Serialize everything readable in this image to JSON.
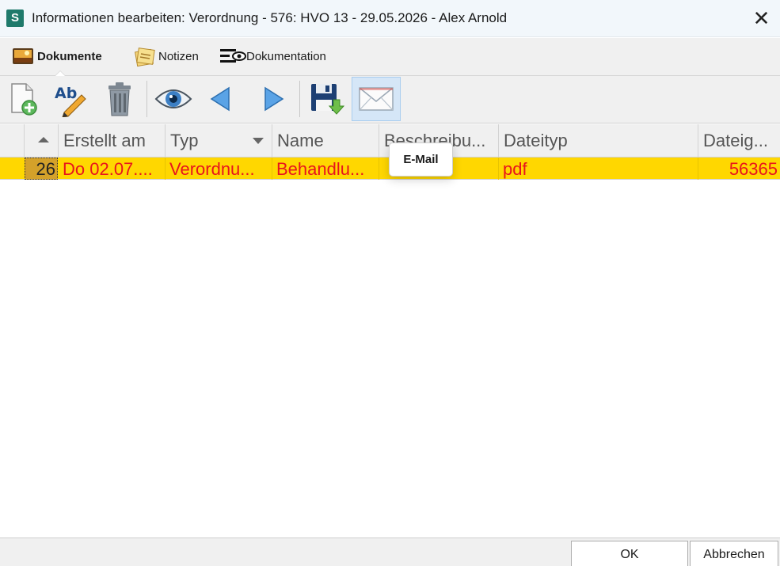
{
  "window": {
    "app_icon_letter": "S",
    "title": "Informationen bearbeiten: Verordnung - 576: HVO 13 - 29.05.2026 - Alex Arnold",
    "close_glyph": "✕"
  },
  "tabs": [
    {
      "label": "Dokumente",
      "icon": "picture-icon",
      "active": true
    },
    {
      "label": "Notizen",
      "icon": "notes-icon",
      "active": false
    },
    {
      "label": "Dokumentation",
      "icon": "documentation-eye-icon",
      "active": false
    }
  ],
  "toolbar": {
    "buttons": [
      {
        "name": "new-document",
        "icon": "new-document-icon"
      },
      {
        "name": "rename",
        "icon": "rename-pencil-icon"
      },
      {
        "name": "delete",
        "icon": "trash-icon"
      },
      {
        "name": "view",
        "icon": "eye-icon"
      },
      {
        "name": "previous",
        "icon": "arrow-left-icon"
      },
      {
        "name": "next",
        "icon": "arrow-right-icon"
      },
      {
        "name": "save",
        "icon": "save-download-icon"
      },
      {
        "name": "email",
        "icon": "envelope-icon",
        "hovered": true
      }
    ],
    "tooltip": "E-Mail"
  },
  "grid": {
    "columns": [
      "Erstellt am",
      "Typ",
      "Name",
      "Beschreibu...",
      "Dateityp",
      "Dateig..."
    ],
    "sort_indicator": "ascending",
    "rows": [
      {
        "id": "26",
        "cells": [
          "Do 02.07....",
          "Verordnu...",
          "Behandlu...",
          "",
          "pdf",
          "56365"
        ]
      }
    ]
  },
  "colors": {
    "selected_row_bg": "#ffd700",
    "row_text": "#e8141c",
    "id_cell_bg": "#d4a12a",
    "hover_button_bg": "#d5e6f7"
  },
  "footer": {
    "ok_label": "OK",
    "cancel_label": "Abbrechen"
  }
}
